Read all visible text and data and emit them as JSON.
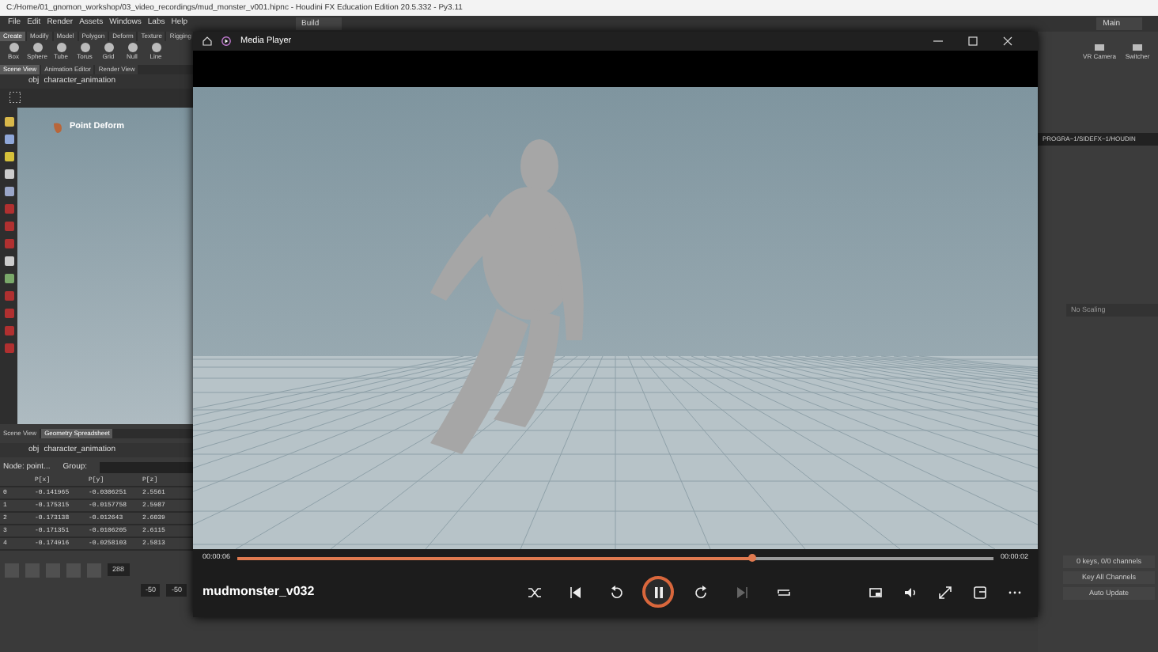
{
  "window": {
    "title": "C:/Home/01_gnomon_workshop/03_video_recordings/mud_monster_v001.hipnc - Houdini FX Education Edition 20.5.332 - Py3.11"
  },
  "menu": [
    "File",
    "Edit",
    "Render",
    "Assets",
    "Windows",
    "Labs",
    "Help"
  ],
  "desktops": [
    {
      "label": "Build"
    },
    {
      "label": "Main"
    }
  ],
  "shelf": {
    "tabs": [
      {
        "label": "Create",
        "selected": true
      },
      {
        "label": "Modify",
        "selected": false
      },
      {
        "label": "Model",
        "selected": false
      },
      {
        "label": "Polygon",
        "selected": false
      },
      {
        "label": "Deform",
        "selected": false
      },
      {
        "label": "Texture",
        "selected": false
      },
      {
        "label": "Rigging",
        "selected": false
      }
    ],
    "tools": [
      "Box",
      "Sphere",
      "Tube",
      "Torus",
      "Grid",
      "Null",
      "Line"
    ]
  },
  "scene_pane": {
    "tabs": [
      {
        "label": "Scene View",
        "selected": true
      },
      {
        "label": "Animation Editor",
        "selected": false
      },
      {
        "label": "Render View",
        "selected": false
      }
    ],
    "path": [
      "obj",
      "character_animation"
    ],
    "node_label": "Point Deform"
  },
  "spreadsheet": {
    "tabs": [
      {
        "label": "Scene View",
        "selected": false
      },
      {
        "label": "Geometry Spreadsheet",
        "selected": true
      }
    ],
    "path": [
      "obj",
      "character_animation"
    ],
    "node": "Node: point...",
    "group_label": "Group:",
    "columns": [
      "",
      "P[x]",
      "P[y]",
      "P[z]"
    ],
    "rows": [
      [
        "0",
        "-0.141965",
        "-0.0306251",
        "2.5561"
      ],
      [
        "1",
        "-0.175315",
        "-0.0157758",
        "2.5987"
      ],
      [
        "2",
        "-0.173138",
        "-0.012643",
        "2.6039"
      ],
      [
        "3",
        "-0.171351",
        "-0.0106205",
        "2.6115"
      ],
      [
        "4",
        "-0.174916",
        "-0.0258103",
        "2.5813"
      ]
    ]
  },
  "playbar": {
    "frame": "288",
    "start": "-50",
    "end": "-50"
  },
  "right_panel": {
    "tools": [
      "VR Camera",
      "Switcher"
    ],
    "path": "PROGRA~1/SIDEFX~1/HOUDIN",
    "scaling": "No Scaling",
    "keys": "0 keys, 0/0 channels",
    "key_all": "Key All Channels",
    "auto_update": "Auto Update"
  },
  "media_player": {
    "title": "Media Player",
    "elapsed": "00:00:06",
    "remaining": "00:00:02",
    "level": 0.68,
    "track": "mudmonster_v032",
    "controls": [
      {
        "kind": "shuffle",
        "disabled": false
      },
      {
        "kind": "previous",
        "disabled": false
      },
      {
        "kind": "rewind",
        "disabled": false
      },
      {
        "kind": "pause",
        "disabled": false
      },
      {
        "kind": "forward",
        "disabled": false
      },
      {
        "kind": "next",
        "disabled": true
      },
      {
        "kind": "repeat",
        "disabled": false
      }
    ],
    "extras": [
      {
        "kind": "miniplayer"
      },
      {
        "kind": "volume"
      },
      {
        "kind": "fullscreen"
      },
      {
        "kind": "cast"
      },
      {
        "kind": "more"
      }
    ]
  }
}
